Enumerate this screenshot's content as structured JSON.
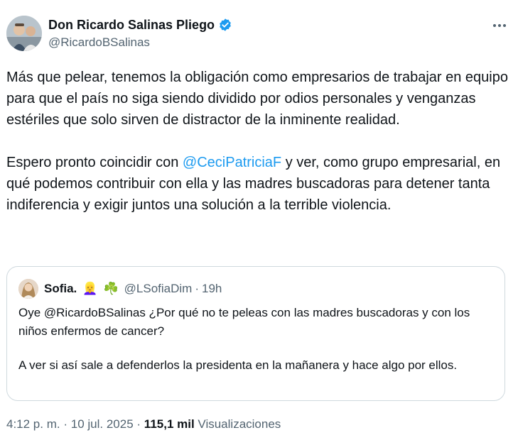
{
  "author": {
    "name": "Don Ricardo Salinas Pliego",
    "handle": "@RicardoBSalinas",
    "verified_color": "#1d9bf0"
  },
  "post": {
    "paragraph1": "Más que pelear, tenemos la obligación como empresarios de trabajar en equipo para que el país no siga siendo dividido por odios personales y venganzas estériles que solo sirven de distractor de la inminente realidad.",
    "paragraph2_before": "Espero pronto coincidir con ",
    "paragraph2_mention": "@CeciPatriciaF",
    "paragraph2_after": " y ver, como grupo empresarial, en qué podemos contribuir con ella y las madres buscadoras para detener tanta indiferencia y exigir juntos una solución a la terrible violencia.",
    "mention_color": "#1d9bf0"
  },
  "quote": {
    "name": "Sofia.",
    "emoji1": "👱‍♀️",
    "emoji2": "☘️",
    "handle": "@LSofiaDim",
    "separator": "·",
    "time": "19h",
    "paragraph1": "Oye @RicardoBSalinas ¿Por qué no te peleas con las madres buscadoras y con los niños enfermos de cancer?",
    "paragraph2": "A ver si así sale a defenderlos la presidenta en la mañanera y hace algo por ellos."
  },
  "meta": {
    "time": "4:12 p. m.",
    "sep1": "·",
    "date": "10 jul. 2025",
    "sep2": "·",
    "views_count": "115,1 mil",
    "views_label": "Visualizaciones"
  }
}
